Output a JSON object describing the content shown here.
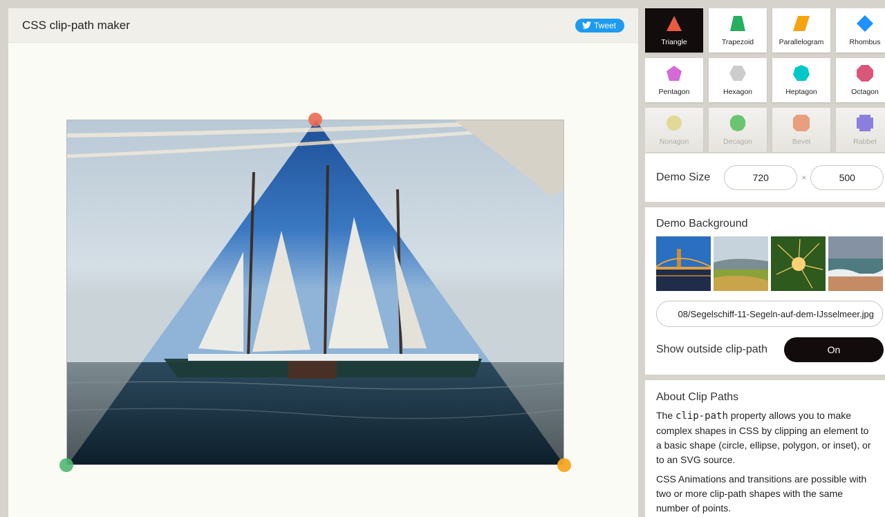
{
  "header": {
    "title": "CSS clip-path maker",
    "tweet_label": "Tweet"
  },
  "shapes": [
    {
      "label": "Triangle",
      "icon": "triangle-icon",
      "color": "#ec5a40",
      "state": "active"
    },
    {
      "label": "Trapezoid",
      "icon": "trapezoid-icon",
      "color": "#27ae60",
      "state": "normal"
    },
    {
      "label": "Parallelogram",
      "icon": "parallelogram-icon",
      "color": "#f5a40f",
      "state": "normal"
    },
    {
      "label": "Rhombus",
      "icon": "rhombus-icon",
      "color": "#1e90ff",
      "state": "normal"
    },
    {
      "label": "Pentagon",
      "icon": "pentagon-icon",
      "color": "#d36ad6",
      "state": "normal"
    },
    {
      "label": "Hexagon",
      "icon": "hexagon-icon",
      "color": "#cccccc",
      "state": "normal"
    },
    {
      "label": "Heptagon",
      "icon": "heptagon-icon",
      "color": "#00c8c8",
      "state": "normal"
    },
    {
      "label": "Octagon",
      "icon": "octagon-icon",
      "color": "#d9577a",
      "state": "normal"
    },
    {
      "label": "Nonagon",
      "icon": "nonagon-icon",
      "color": "#e8dc82",
      "state": "faded"
    },
    {
      "label": "Decagon",
      "icon": "decagon-icon",
      "color": "#3cc04a",
      "state": "faded"
    },
    {
      "label": "Bevel",
      "icon": "bevel-icon",
      "color": "#f08a5d",
      "state": "faded"
    },
    {
      "label": "Rabbet",
      "icon": "rabbet-icon",
      "color": "#6c5ce7",
      "state": "faded"
    }
  ],
  "demo_size": {
    "label": "Demo Size",
    "width": "720",
    "height": "500",
    "separator": "×"
  },
  "demo_background": {
    "title": "Demo Background",
    "thumbnails": [
      "bridge-at-night",
      "green-valley",
      "sparkler",
      "beach-waves"
    ],
    "url_value": "08/Segelschiff-11-Segeln-auf-dem-IJsselmeer.jpg",
    "toggle_label": "Show outside clip-path",
    "toggle_value": "On"
  },
  "about": {
    "title": "About Clip Paths",
    "p1_before": "The ",
    "p1_code": "clip-path",
    "p1_after": " property allows you to make complex shapes in CSS by clipping an element to a basic shape (circle, ellipse, polygon, or inset), or to an SVG source.",
    "p2": "CSS Animations and transitions are possible with two or more clip-path shapes with the same number of points."
  },
  "colors": {
    "accent_dark": "#120d0c",
    "tweet_blue": "#1d9bf0",
    "handle_top": "#ec6a52",
    "handle_left": "#4fb872",
    "handle_right": "#f5a623"
  }
}
